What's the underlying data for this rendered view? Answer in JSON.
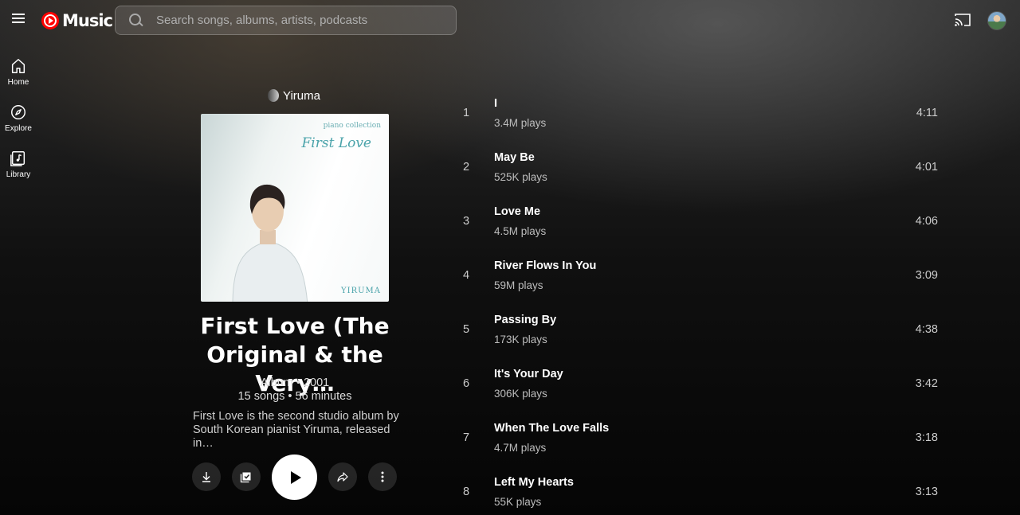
{
  "header": {
    "logo_text": "Music",
    "search_placeholder": "Search songs, albums, artists, podcasts"
  },
  "nav": {
    "items": [
      {
        "label": "Home",
        "icon": "home-icon"
      },
      {
        "label": "Explore",
        "icon": "compass-icon"
      },
      {
        "label": "Library",
        "icon": "library-icon"
      }
    ]
  },
  "album": {
    "artist": "Yiruma",
    "cover_series": "piano collection",
    "cover_title": "First Love",
    "cover_artist": "YIRUMA",
    "title": "First Love (The Original & the Very…",
    "type_year": "Album • 2001",
    "stats": "15 songs • 56 minutes",
    "description": "First Love is the second studio album by South Korean pianist Yiruma, released in…"
  },
  "actions": {
    "download": "download-icon",
    "save": "save-to-library-icon",
    "play": "play-icon",
    "share": "share-icon",
    "more": "more-vert-icon"
  },
  "tracks": [
    {
      "num": "1",
      "title": "I",
      "plays": "3.4M plays",
      "duration": "4:11"
    },
    {
      "num": "2",
      "title": "May Be",
      "plays": "525K plays",
      "duration": "4:01"
    },
    {
      "num": "3",
      "title": "Love Me",
      "plays": "4.5M plays",
      "duration": "4:06"
    },
    {
      "num": "4",
      "title": "River Flows In You",
      "plays": "59M plays",
      "duration": "3:09"
    },
    {
      "num": "5",
      "title": "Passing By",
      "plays": "173K plays",
      "duration": "4:38"
    },
    {
      "num": "6",
      "title": "It's Your Day",
      "plays": "306K plays",
      "duration": "3:42"
    },
    {
      "num": "7",
      "title": "When The Love Falls",
      "plays": "4.7M plays",
      "duration": "3:18"
    },
    {
      "num": "8",
      "title": "Left My Hearts",
      "plays": "55K plays",
      "duration": "3:13"
    }
  ]
}
